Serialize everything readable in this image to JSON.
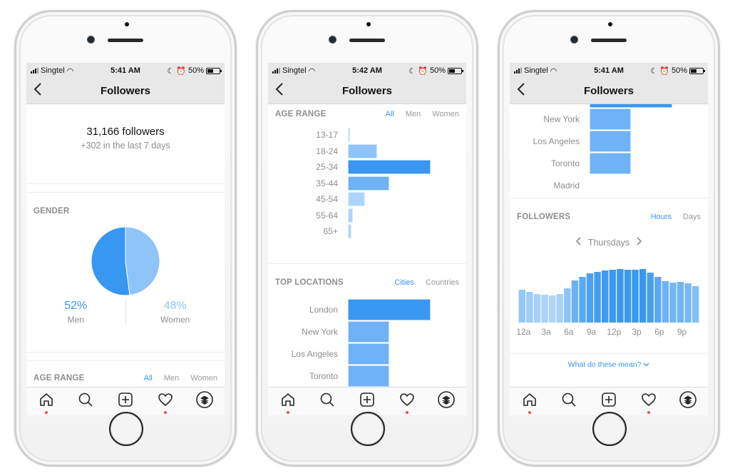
{
  "colors": {
    "accent": "#3897f0",
    "bar_dark": "#3897f0",
    "bar_mid": "#6fb2f5",
    "bar_light": "#8ec4f8",
    "bar_lighter": "#add5fb",
    "notification_dot": "#ed4956"
  },
  "phones": [
    {
      "status": {
        "carrier": "Singtel",
        "time": "5:41 AM",
        "battery": "50%"
      },
      "nav": {
        "title": "Followers",
        "back_icon": "chevron-left-icon"
      },
      "summary": {
        "count": "31,166 followers",
        "delta": "+302 in the last 7 days"
      },
      "gender": {
        "title": "GENDER",
        "men_pct": "52%",
        "men_label": "Men",
        "women_pct": "48%",
        "women_label": "Women"
      },
      "age_range": {
        "title": "AGE RANGE",
        "toggles": [
          "All",
          "Men",
          "Women"
        ],
        "active": "All",
        "visible_rows": [
          "13-17"
        ]
      }
    },
    {
      "status": {
        "carrier": "Singtel",
        "time": "5:42 AM",
        "battery": "50%"
      },
      "nav": {
        "title": "Followers",
        "back_icon": "chevron-left-icon"
      },
      "age_range": {
        "title": "AGE RANGE",
        "toggles": [
          "All",
          "Men",
          "Women"
        ],
        "active": "All"
      },
      "top_locations": {
        "title": "TOP LOCATIONS",
        "toggles": [
          "Cities",
          "Countries"
        ],
        "active": "Cities"
      }
    },
    {
      "status": {
        "carrier": "Singtel",
        "time": "5:41 AM",
        "battery": "50%"
      },
      "nav": {
        "title": "Followers",
        "back_icon": "chevron-left-icon"
      },
      "followers_activity": {
        "title": "FOLLOWERS",
        "toggles": [
          "Hours",
          "Days"
        ],
        "active": "Hours",
        "day_label": "Thursdays",
        "prev_icon": "chevron-left-icon",
        "next_icon": "chevron-right-icon"
      },
      "help_link": "What do these mean?"
    }
  ],
  "tabbar": {
    "items": [
      "home-icon",
      "search-icon",
      "add-post-icon",
      "heart-activity-icon",
      "profile-icon"
    ],
    "dots_on": [
      "home-icon",
      "heart-activity-icon"
    ]
  },
  "chart_data": [
    {
      "type": "pie",
      "title": "GENDER",
      "categories": [
        "Men",
        "Women"
      ],
      "values": [
        52,
        48
      ],
      "unit": "%"
    },
    {
      "type": "bar",
      "orientation": "horizontal",
      "title": "AGE RANGE",
      "filter": "All",
      "categories": [
        "13-17",
        "18-24",
        "25-34",
        "35-44",
        "45-54",
        "55-64",
        "65+"
      ],
      "values": [
        1,
        12,
        34,
        17,
        7,
        2,
        1.5
      ],
      "unit": "% (estimated)"
    },
    {
      "type": "bar",
      "orientation": "horizontal",
      "title": "TOP LOCATIONS",
      "filter": "Cities",
      "categories": [
        "London",
        "New York",
        "Los Angeles",
        "Toronto",
        "Madrid"
      ],
      "values": [
        100,
        50,
        50,
        50,
        0
      ],
      "unit": "relative (estimated)"
    },
    {
      "type": "bar",
      "title": "FOLLOWERS",
      "subtitle": "Thursdays",
      "mode": "Hours",
      "x": [
        "12a",
        "1a",
        "2a",
        "3a",
        "4a",
        "5a",
        "6a",
        "7a",
        "8a",
        "9a",
        "10a",
        "11a",
        "12p",
        "1p",
        "2p",
        "3p",
        "4p",
        "5p",
        "6p",
        "7p",
        "8p",
        "9p",
        "10p",
        "11p"
      ],
      "tick_labels": [
        "12a",
        "3a",
        "6a",
        "9a",
        "12p",
        "3p",
        "6p",
        "9p"
      ],
      "values": [
        46,
        43,
        40,
        39,
        38,
        40,
        48,
        59,
        64,
        69,
        71,
        73,
        74,
        75,
        74,
        74,
        75,
        70,
        64,
        58,
        56,
        57,
        55,
        51
      ],
      "ylim": [
        0,
        80
      ],
      "grid": false,
      "unit": "relative activity (estimated)"
    }
  ]
}
